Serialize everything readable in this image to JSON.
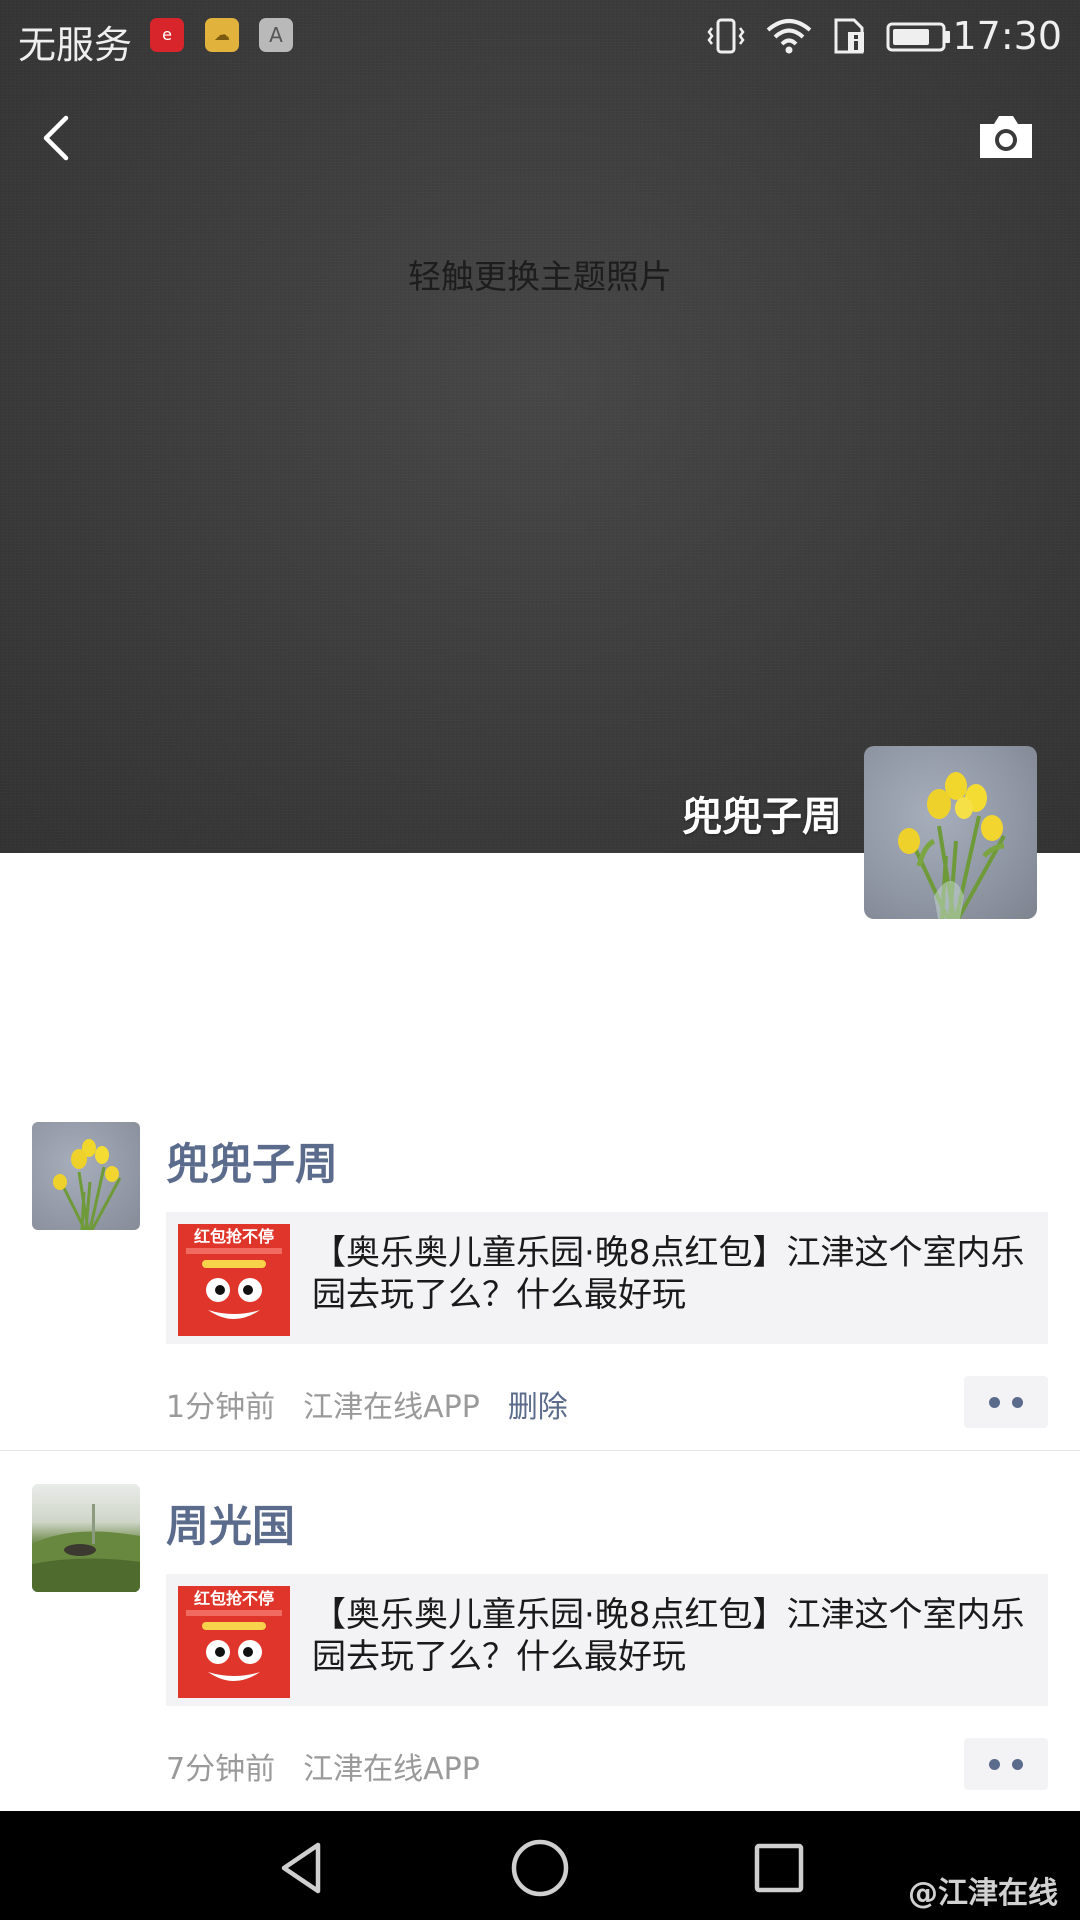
{
  "status_bar": {
    "carrier": "无服务",
    "time": "17:30",
    "icons": [
      "vibrate-icon",
      "wifi-icon",
      "sim-info-icon",
      "battery-icon"
    ],
    "notification_apps": [
      "jiangjin-app-icon",
      "cloud-app-icon",
      "a-app-icon"
    ]
  },
  "header": {
    "back_icon": "chevron-left-icon",
    "camera_icon": "camera-icon"
  },
  "cover": {
    "hint": "轻触更换主题照片",
    "user_name": "兜兜子周"
  },
  "posts": [
    {
      "name": "兜兜子周",
      "share_title": "【奥乐奥儿童乐园·晚8点红包】江津这个室内乐园去玩了么？什么最好玩",
      "time": "1分钟前",
      "source": "江津在线APP",
      "delete_label": "删除",
      "thumb_banner": "红包抢不停"
    },
    {
      "name": "周光国",
      "share_title": "【奥乐奥儿童乐园·晚8点红包】江津这个室内乐园去玩了么？什么最好玩",
      "time": "7分钟前",
      "source": "江津在线APP",
      "thumb_banner": "红包抢不停"
    }
  ],
  "nav": {
    "buttons": [
      "back-triangle-icon",
      "home-circle-icon",
      "recents-square-icon"
    ]
  },
  "watermark": "@江津在线",
  "colors": {
    "link_blue": "#5b6b8c",
    "meta_gray": "#9a9a9a",
    "card_bg": "#f3f3f5"
  }
}
